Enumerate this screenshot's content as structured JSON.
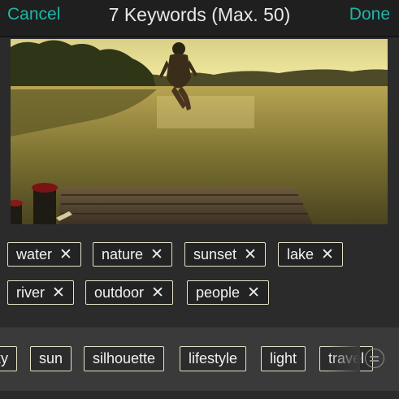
{
  "nav": {
    "cancel_label": "Cancel",
    "title": "7 Keywords (Max. 50)",
    "done_label": "Done",
    "accent_color": "#1fb5a8"
  },
  "selected_keywords": [
    "water",
    "nature",
    "sunset",
    "lake",
    "river",
    "outdoor",
    "people"
  ],
  "remove_glyph": "✕",
  "suggested_keywords": [
    "sky",
    "sun",
    "silhouette",
    "lifestyle",
    "light",
    "travel"
  ],
  "menu_icon": "menu-circle-icon"
}
